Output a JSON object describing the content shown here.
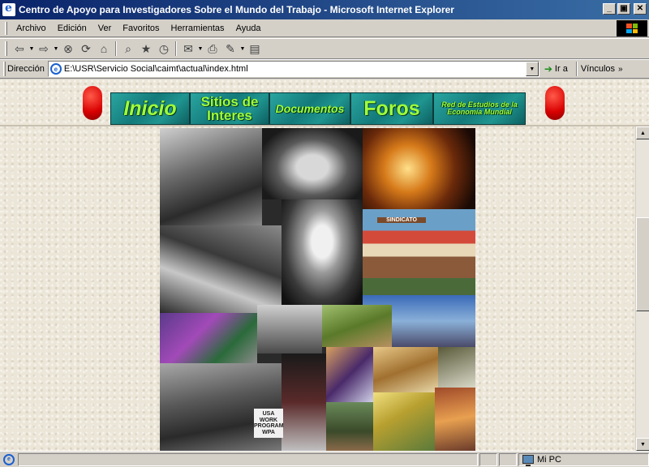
{
  "window": {
    "title": "Centro de Apoyo para Investigadores Sobre el Mundo del Trabajo - Microsoft Internet Explorer",
    "controls": {
      "minimize": "_",
      "maximize": "▣",
      "close": "✕"
    }
  },
  "menubar": {
    "items": [
      "Archivo",
      "Edición",
      "Ver",
      "Favoritos",
      "Herramientas",
      "Ayuda"
    ]
  },
  "toolbar": {
    "buttons": [
      "back-icon",
      "forward-icon",
      "stop-icon",
      "refresh-icon",
      "home-icon",
      "search-icon",
      "favorites-icon",
      "history-icon",
      "mail-icon",
      "print-icon",
      "edit-icon",
      "discuss-icon"
    ]
  },
  "addressbar": {
    "label": "Dirección",
    "url": "E:\\USR\\Servicio Social\\caimt\\actual\\index.html",
    "go_label": "Ir a",
    "links_label": "Vínculos",
    "links_more": "»"
  },
  "nav": {
    "inicio": "Inicio",
    "sitios": "Sitios de Interes",
    "documentos": "Documentos",
    "foros": "Foros",
    "red": "Red de Estudios de la Economía Mundial"
  },
  "collage": {
    "sindicato_sign": "SINDICATO",
    "wpa_sign": "USA WORK PROGRAM WPA"
  },
  "statusbar": {
    "zone": "Mi PC"
  },
  "colors": {
    "titlebar_start": "#0a246a",
    "titlebar_end": "#3a6ea5",
    "nav_text": "#9fff3c",
    "nav_bg": "#137a7a",
    "pill_red": "#d80000"
  }
}
